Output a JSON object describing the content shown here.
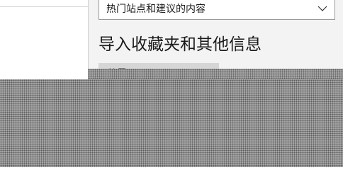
{
  "startup": {
    "dropdown_value": "热门站点和建议的内容"
  },
  "import_section": {
    "title": "导入收藏夹和其他信息",
    "button_label": "从另"
  },
  "icons": {
    "dropdown_chevron": "chevron-down-icon"
  },
  "colors": {
    "panel_background": "#f3f3f3",
    "button_background": "#d6d6d6",
    "redaction_overlay": "#a8a8a8"
  }
}
